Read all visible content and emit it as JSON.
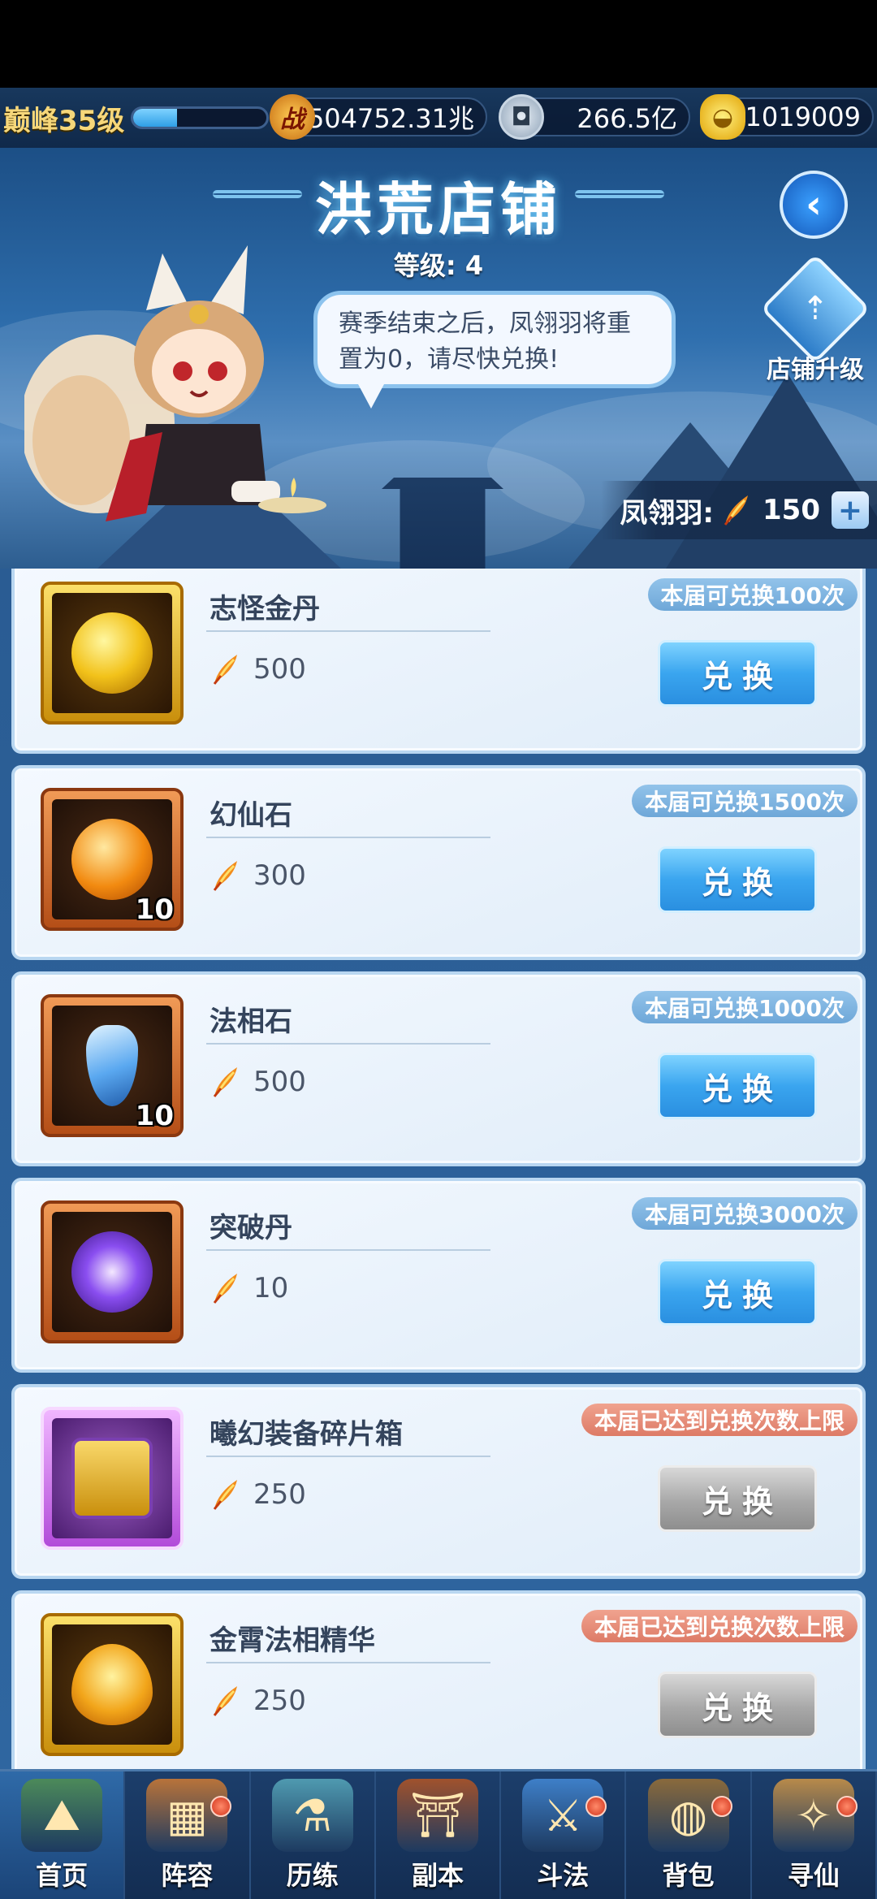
{
  "hud": {
    "level_label": "巅峰35级",
    "xp_progress": 0.33,
    "power_icon_glyph": "战",
    "power_value": "504752.31兆",
    "silver_value": "266.5亿",
    "gold_value": "1019009"
  },
  "banner": {
    "title": "洪荒店铺",
    "shop_level": "等级: 4",
    "speech": "赛季结束之后，凤翎羽将重置为0，请尽快兑换!",
    "upgrade_label": "店铺升级",
    "currency_label": "凤翎羽:",
    "currency_value": "150"
  },
  "exchange_label": "兑换",
  "items": [
    {
      "name": "志怪金丹",
      "price": "500",
      "limit": "本届可兑换100次",
      "maxed": false,
      "qty": "",
      "frame": "gold",
      "orb": "gold"
    },
    {
      "name": "幻仙石",
      "price": "300",
      "limit": "本届可兑换1500次",
      "maxed": false,
      "qty": "10",
      "frame": "orange",
      "orb": "amber"
    },
    {
      "name": "法相石",
      "price": "500",
      "limit": "本届可兑换1000次",
      "maxed": false,
      "qty": "10",
      "frame": "orange",
      "orb": "blue"
    },
    {
      "name": "突破丹",
      "price": "10",
      "limit": "本届可兑换3000次",
      "maxed": false,
      "qty": "",
      "frame": "orange",
      "orb": "violet"
    },
    {
      "name": "曦幻装备碎片箱",
      "price": "250",
      "limit": "本届已达到兑换次数上限",
      "maxed": true,
      "qty": "",
      "frame": "purple",
      "orb": "chest"
    },
    {
      "name": "金霄法相精华",
      "price": "250",
      "limit": "本届已达到兑换次数上限",
      "maxed": true,
      "qty": "",
      "frame": "gold",
      "orb": "flame"
    }
  ],
  "nav": [
    {
      "label": "首页",
      "icon": "home-icon",
      "active": true,
      "dot": false
    },
    {
      "label": "阵容",
      "icon": "lineup-icon",
      "active": false,
      "dot": true
    },
    {
      "label": "历练",
      "icon": "training-icon",
      "active": false,
      "dot": false
    },
    {
      "label": "副本",
      "icon": "dungeon-icon",
      "active": false,
      "dot": false
    },
    {
      "label": "斗法",
      "icon": "battle-icon",
      "active": false,
      "dot": true
    },
    {
      "label": "背包",
      "icon": "bag-icon",
      "active": false,
      "dot": true
    },
    {
      "label": "寻仙",
      "icon": "seek-icon",
      "active": false,
      "dot": true
    }
  ],
  "colors": {
    "exchange_active": "#3aa5ef",
    "exchange_disabled": "#a8a8a8",
    "limit_available": "#6ea7d8",
    "limit_maxed": "#dd7b66"
  }
}
